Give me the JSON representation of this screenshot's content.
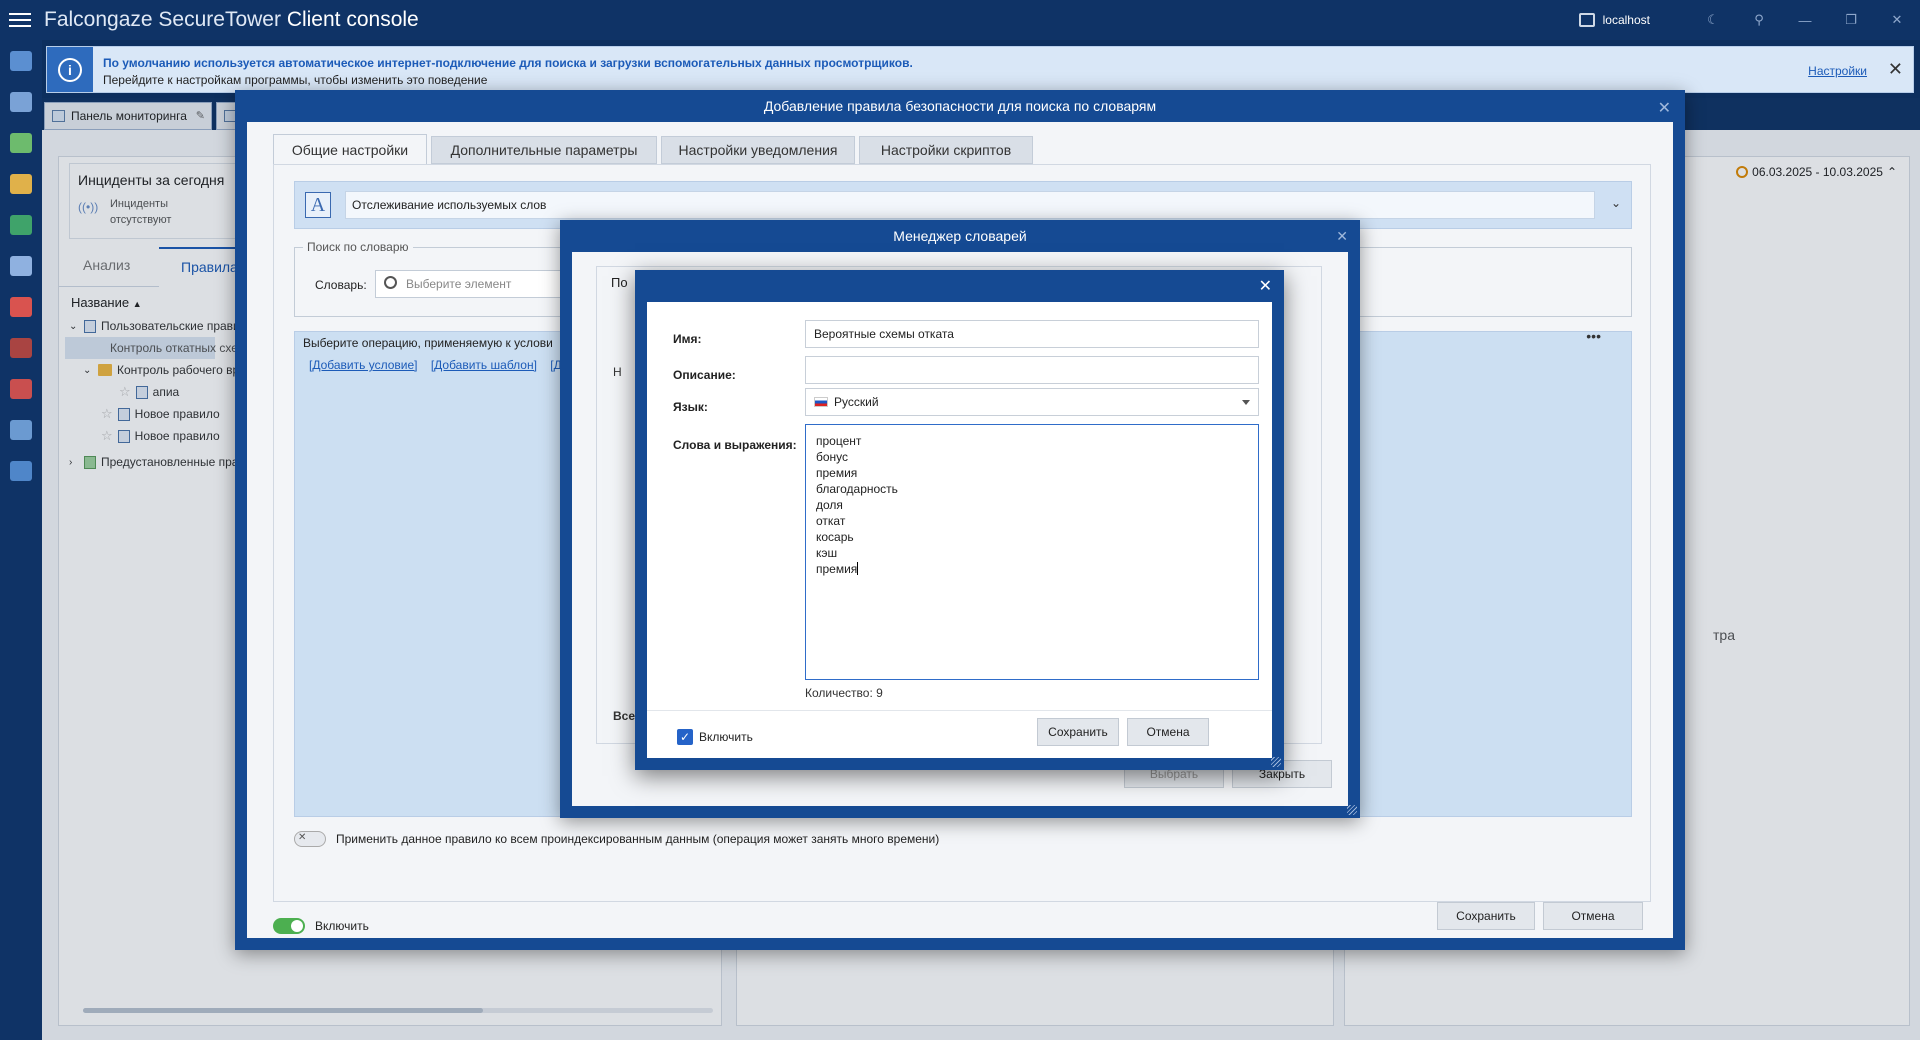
{
  "app": {
    "title_prefix": "Falcongaze SecureTower",
    "title_suffix": "Client console",
    "server": "localhost"
  },
  "banner": {
    "line1": "По умолчанию используется автоматическое интернет-подключение для поиска и загрузки вспомогательных данных просмотрщиков.",
    "line2": "Перейдите к настройкам программы, чтобы изменить это поведение",
    "link": "Настройки"
  },
  "workspace": {
    "tabs": [
      "Панель мониторинга"
    ],
    "incidents_title": "Инциденты за сегодня",
    "incidents_text": "Инциденты отсутствуют",
    "left_tabs": [
      "Анализ",
      "Правила"
    ],
    "tree_header": "Название",
    "tree": [
      "Пользовательские правила",
      "Контроль откатных схем",
      "Контроль рабочего времени",
      "апиа",
      "Новое правило",
      "Новое правило",
      "Предустановленные правила"
    ],
    "date_range": "06.03.2025 - 10.03.2025",
    "right_fragment": "тра"
  },
  "rule_dialog": {
    "title": "Добавление правила безопасности для поиска по словарям",
    "tabs": [
      "Общие настройки",
      "Дополнительные параметры",
      "Настройки уведомления",
      "Настройки скриптов"
    ],
    "rule_name": "Отслеживание используемых слов",
    "dict_group_title": "Поиск по словарю",
    "dict_label": "Словарь:",
    "dict_placeholder": "Выберите элемент",
    "ops_text": "Выберите операцию, применяемую к услови",
    "ops_links": [
      "[Добавить условие]",
      "[Добавить шаблон]",
      "[Д"
    ],
    "apply_all": "Применить данное правило ко всем проиндексированным данным (операция может занять много времени)",
    "enable": "Включить",
    "save": "Сохранить",
    "cancel": "Отмена"
  },
  "dict_manager": {
    "title": "Менеджер словарей",
    "tab": "По",
    "frag_n": "Н",
    "frag_all": "Все",
    "select": "Выбрать",
    "close": "Закрыть"
  },
  "dict_editor": {
    "name_label": "Имя:",
    "name_value": "Вероятные схемы отката",
    "desc_label": "Описание:",
    "desc_value": "",
    "lang_label": "Язык:",
    "lang_value": "Русский",
    "words_label": "Слова и выражения:",
    "words": [
      "процент",
      "бонус",
      "премия",
      "благодарность",
      "доля",
      "откат",
      "косарь",
      "кэш",
      "премия"
    ],
    "count": "Количество: 9",
    "enable": "Включить",
    "save": "Сохранить",
    "cancel": "Отмена"
  },
  "colors": {
    "titlebar": "#0f3366",
    "dialog_frame": "#154a93",
    "accent": "#1c5bb8",
    "toggle_on": "#4caf50"
  }
}
